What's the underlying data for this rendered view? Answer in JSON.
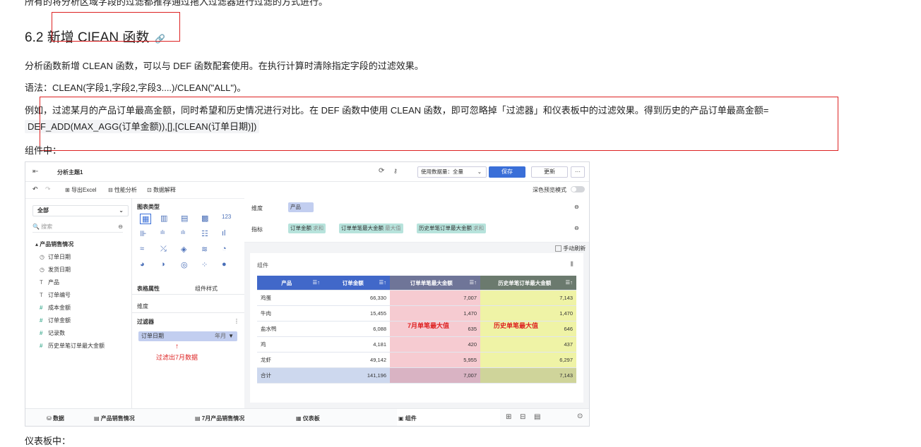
{
  "doc": {
    "top_text": "所有的将分析区域字段的过滤都推荐通过拖入过滤器进行过滤的方式进行。",
    "heading": "6.2 新增 CIEAN 函数",
    "heading_link_icon": "link-icon",
    "p1": "分析函数新增 CLEAN 函数，可以与 DEF 函数配套使用。在执行计算时清除指定字段的过滤效果。",
    "p2": "语法：CLEAN(字段1,字段2,字段3....)/CLEAN(\"ALL\")。",
    "p3": "例如，过滤某月的产品订单最高金额，同时希望和历史情况进行对比。在 DEF 函数中使用 CLEAN 函数，即可忽略掉「过滤器」和仪表板中的过滤效果。得到历史的产品订单最高金额=",
    "p3_code": "DEF_ADD(MAX_AGG(订单金额)),[],[CLEAN(订单日期)])",
    "p4": "组件中：",
    "p5": "仪表板中："
  },
  "shot": {
    "title": "分析主题1",
    "data_perm_label": "使用数据量：全量",
    "save_label": "保存",
    "update_label": "更新",
    "more_label": "···",
    "export_excel": "导出Excel",
    "perf_analysis": "性能分析",
    "data_explain": "数据解释",
    "deep_preview": "深色预览模式",
    "all_label": "全部",
    "search_placeholder": "搜索",
    "table_group": "产品销售情况",
    "fields": [
      "订单日期",
      "发货日期",
      "产品",
      "订单编号",
      "成本金额",
      "订单金额",
      "记录数",
      "历史单笔订单最大金额"
    ],
    "chart_type_label": "图表类型",
    "table_props_label": "表格属性",
    "component_style_label": "组件样式",
    "dimension_small": "维度",
    "filter_label": "过滤器",
    "filter_chip": "订单日期",
    "filter_chip_value": "年月",
    "filter_annotation": "过滤出7月数据",
    "dim_label": "维度",
    "dim_chip": "产品",
    "metric_label": "指标",
    "metric_chips": [
      {
        "name": "订单金额",
        "agg": "求和"
      },
      {
        "name": "订单单笔最大金额",
        "agg": "最大值"
      },
      {
        "name": "历史单笔订单最大金额",
        "agg": "求和"
      }
    ],
    "auto_refresh": "手动刷新",
    "component_label": "组件",
    "table": {
      "headers": [
        "产品",
        "订单金额",
        "订单单笔最大金额",
        "历史单笔订单最大金额"
      ],
      "rows": [
        [
          "鸡蛋",
          "66,330",
          "7,007",
          "7,143"
        ],
        [
          "牛肉",
          "15,455",
          "1,470",
          "1,470"
        ],
        [
          "盐水鸭",
          "6,088",
          "635",
          "646"
        ],
        [
          "鸡",
          "4,181",
          "420",
          "437"
        ],
        [
          "龙虾",
          "49,142",
          "5,955",
          "6,297"
        ],
        [
          "合计",
          "141,196",
          "7,007",
          "7,143"
        ]
      ]
    },
    "overlay_july": "7月单笔最大值",
    "overlay_history": "历史单笔最大值",
    "bottom_tabs": [
      "数据",
      "产品销售情况",
      "7月产品销售情况",
      "仪表板",
      "组件"
    ]
  },
  "colors": {
    "red": "#d22222",
    "blue": "#3a6fd8",
    "header_dark": "#4a5a8a",
    "pink": "#f4c4cb",
    "yellow": "#eef2a0",
    "teal": "#b7e3dc"
  }
}
